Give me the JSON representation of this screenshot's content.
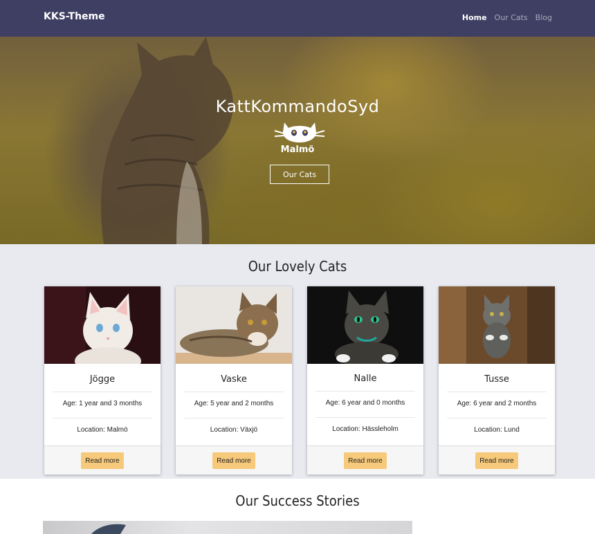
{
  "navbar": {
    "brand": "KKS-Theme",
    "links": [
      {
        "label": "Home",
        "active": true
      },
      {
        "label": "Our Cats",
        "active": false
      },
      {
        "label": "Blog",
        "active": false
      }
    ]
  },
  "hero": {
    "title": "KattKommandoSyd",
    "city": "Malmö",
    "button_label": "Our Cats",
    "logo_icon": "cat-face-icon"
  },
  "cats": {
    "title": "Our Lovely Cats",
    "items": [
      {
        "name": "Jögge",
        "age": "Age: 1 year and 3 months",
        "location": "Location: Malmö",
        "button": "Read more"
      },
      {
        "name": "Vaske",
        "age": "Age: 5 year and 2 months",
        "location": "Location: Växjö",
        "button": "Read more"
      },
      {
        "name": "Nalle",
        "age": "Age: 6 year and 0 months",
        "location": "Location: Hässleholm",
        "button": "Read more"
      },
      {
        "name": "Tusse",
        "age": "Age: 6 year and 2 months",
        "location": "Location: Lund",
        "button": "Read more"
      }
    ]
  },
  "stories": {
    "title": "Our Success Stories"
  },
  "colors": {
    "navbar": "#3f3f63",
    "section_bg": "#e8eaf0",
    "button": "#f7c97a"
  }
}
